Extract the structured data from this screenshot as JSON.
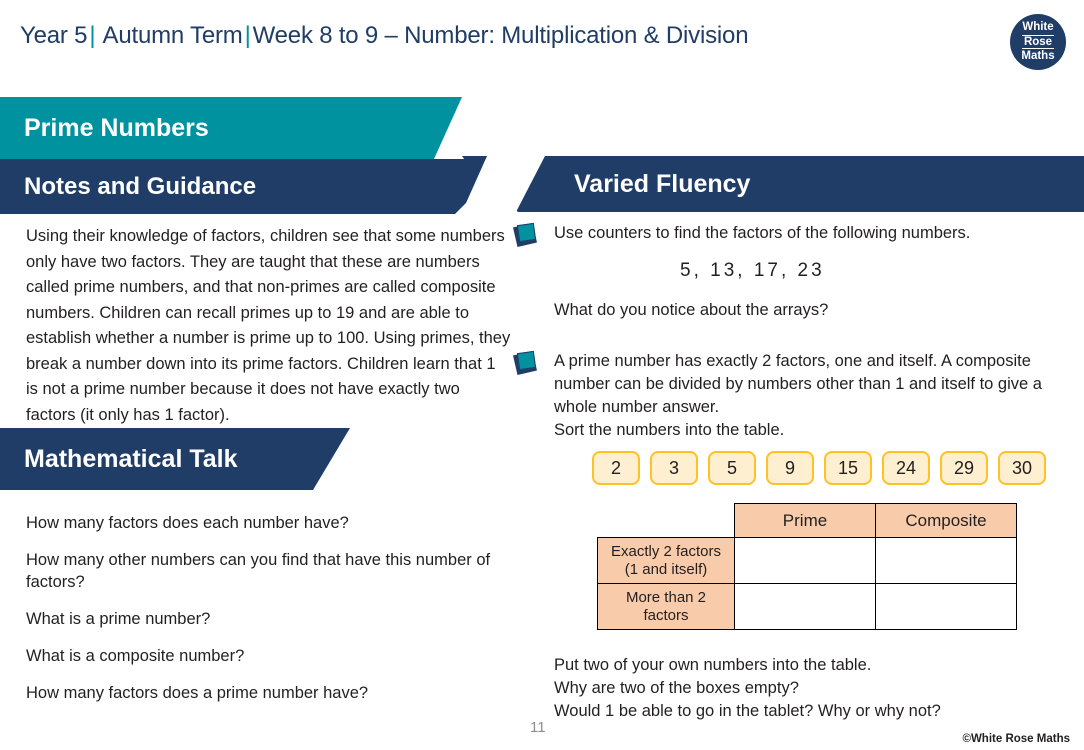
{
  "header": {
    "year": "Year 5",
    "term": "Autumn Term",
    "week": "Week 8 to 9 – Number: Multiplication & Division",
    "separator": "|",
    "logo": {
      "line1": "White",
      "line2": "Rose",
      "line3": "Maths"
    },
    "colors": {
      "navy": "#1F3D66",
      "teal": "#00929E"
    }
  },
  "left": {
    "topic_banner": "Prime Numbers",
    "notes_banner": "Notes and Guidance",
    "notes_body": "Using their knowledge of factors, children see that some numbers only have two factors.  They are taught that these are numbers called prime numbers, and that non-primes are called composite numbers. Children can recall primes up to 19 and are able to establish whether a number is prime up to 100. Using primes, they break a number down into its prime factors.  Children learn that 1 is not a prime number because it does not have exactly two factors (it only has 1 factor).",
    "talk_banner": "Mathematical Talk",
    "talk_questions": [
      "How many factors does each number have?",
      "How many other numbers can you find that have this number of factors?",
      "What is a prime number?",
      "What is a composite number?",
      "How many factors does a prime number have?"
    ]
  },
  "right": {
    "banner": "Varied Fluency",
    "q1": {
      "prompt": "Use counters to find the factors of the following numbers.",
      "numbers": "5,   13,   17,   23",
      "follow_up": "What do you notice about the arrays?"
    },
    "q2": {
      "prompt": "A prime number has exactly 2 factors, one and itself. A composite number can be divided by numbers other than 1 and itself to give a whole number answer.",
      "instruction": "Sort the numbers into the table.",
      "cards": [
        "2",
        "3",
        "5",
        "9",
        "15",
        "24",
        "29",
        "30"
      ],
      "table": {
        "corner": "",
        "columns": [
          "Prime",
          "Composite"
        ],
        "rows": [
          {
            "label_line1": "Exactly 2 factors",
            "label_line2": "(1 and itself)",
            "cells": [
              "",
              ""
            ]
          },
          {
            "label_line1": "More than 2",
            "label_line2": "factors",
            "cells": [
              "",
              ""
            ]
          }
        ]
      },
      "closing": [
        "Put two of your own numbers into the table.",
        "Why are two of the boxes empty?",
        "Would 1 be able to go in the tablet? Why or why not?"
      ]
    }
  },
  "footer": {
    "page_number": "11",
    "copyright": "©White Rose Maths"
  }
}
